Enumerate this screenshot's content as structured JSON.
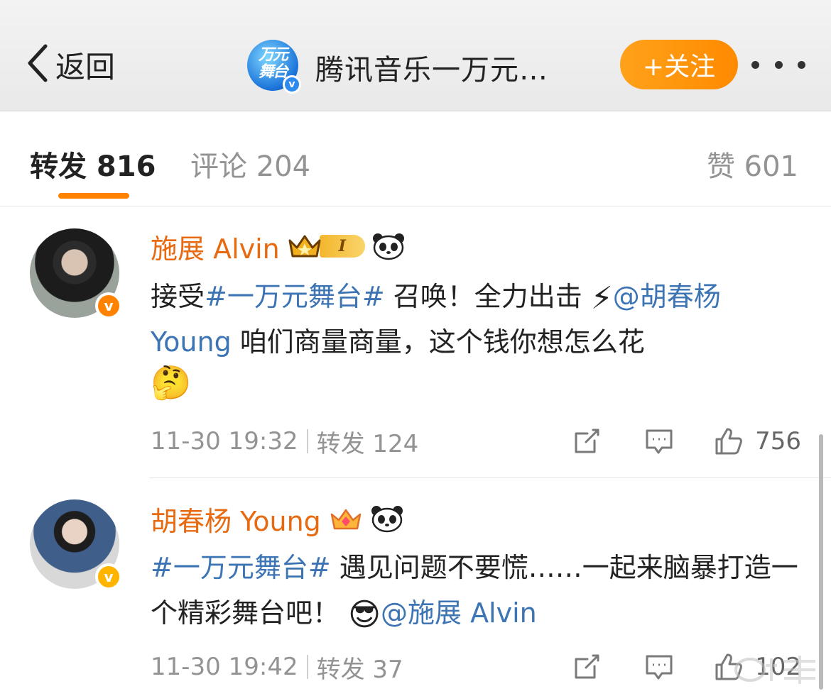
{
  "header": {
    "back_label": "返回",
    "account_title": "腾讯音乐一万元…",
    "logo_text": "万元舞台",
    "follow_label": "+关注"
  },
  "tabs": {
    "repost": "转发 816",
    "comment": "评论 204",
    "like": "赞 601"
  },
  "posts": [
    {
      "user": "施展 Alvin",
      "level": "I",
      "content": {
        "p1": "接受",
        "hashtag": "#一万元舞台#",
        "p2": " 召唤！全力出击",
        "emoji1": "⚡",
        "mention": "@胡春杨 Young",
        "p3": " 咱们商量商量，这个钱你想怎么花",
        "emoji2": "🤔"
      },
      "time": "11-30 19:32",
      "repost": "转发 124",
      "likes": "756"
    },
    {
      "user": "胡春杨 Young",
      "content": {
        "hashtag": "#一万元舞台#",
        "p1": " 遇见问题不要慌……一起来脑暴打造一个精彩舞台吧！",
        "emoji1": "😎",
        "mention": "@施展 Alvin"
      },
      "time": "11-30 19:42",
      "repost": "转发 37",
      "likes": "102"
    }
  ],
  "colors": {
    "accent": "#ff8200",
    "username": "#e86a10",
    "link": "#3d74b4",
    "muted": "#939393"
  },
  "icons": [
    "chevron-left-icon",
    "more-icon",
    "crown-icon",
    "panda-icon",
    "share-icon",
    "comment-icon",
    "like-icon",
    "verified-icon"
  ]
}
